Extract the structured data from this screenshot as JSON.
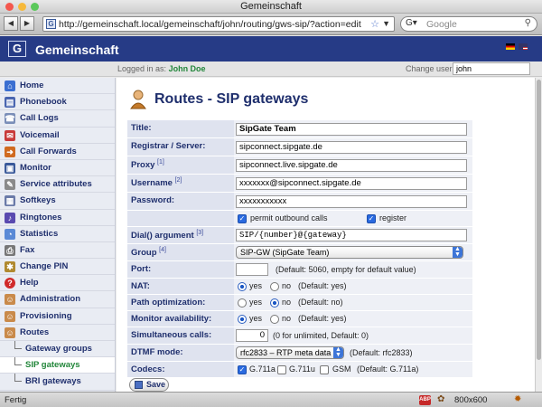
{
  "window": {
    "title": "Gemeinschaft"
  },
  "browser": {
    "url": "http://gemeinschaft.local/gemeinschaft/john/routing/gws-sip/?action=edit",
    "search_placeholder": "Google",
    "status": "Fertig",
    "resolution": "800x600"
  },
  "app": {
    "name": "Gemeinschaft",
    "logo_letter": "G"
  },
  "userbar": {
    "logged_label": "Logged in as:",
    "user": "John Doe",
    "change_label": "Change user:",
    "change_value": "john"
  },
  "sidebar": {
    "items": [
      {
        "label": "Home",
        "icon": "home-icon"
      },
      {
        "label": "Phonebook",
        "icon": "phonebook-icon"
      },
      {
        "label": "Call Logs",
        "icon": "call-logs-icon"
      },
      {
        "label": "Voicemail",
        "icon": "voicemail-icon"
      },
      {
        "label": "Call Forwards",
        "icon": "call-forwards-icon"
      },
      {
        "label": "Monitor",
        "icon": "monitor-icon"
      },
      {
        "label": "Service attributes",
        "icon": "service-attributes-icon"
      },
      {
        "label": "Softkeys",
        "icon": "softkeys-icon"
      },
      {
        "label": "Ringtones",
        "icon": "ringtones-icon"
      },
      {
        "label": "Statistics",
        "icon": "statistics-icon"
      },
      {
        "label": "Fax",
        "icon": "fax-icon"
      },
      {
        "label": "Change PIN",
        "icon": "change-pin-icon"
      },
      {
        "label": "Help",
        "icon": "help-icon"
      },
      {
        "label": "Administration",
        "icon": "administration-icon"
      },
      {
        "label": "Provisioning",
        "icon": "provisioning-icon"
      },
      {
        "label": "Routes",
        "icon": "routes-icon"
      },
      {
        "label": "Gateway groups",
        "sub": true
      },
      {
        "label": "SIP gateways",
        "sub": true,
        "active": true
      },
      {
        "label": "BRI gateways",
        "sub": true
      }
    ]
  },
  "page": {
    "title": "Routes - SIP gateways"
  },
  "form": {
    "title_label": "Title:",
    "title_value": "SipGate Team",
    "registrar_label": "Registrar / Server:",
    "registrar_value": "sipconnect.sipgate.de",
    "proxy_label": "Proxy",
    "proxy_ref": "[1]",
    "proxy_value": "sipconnect.live.sipgate.de",
    "username_label": "Username",
    "username_ref": "[2]",
    "username_value": "xxxxxxx@sipconnect.sipgate.de",
    "password_label": "Password:",
    "password_value": "xxxxxxxxxxx",
    "permit_label": "permit outbound calls",
    "register_label": "register",
    "dial_label": "Dial() argument",
    "dial_ref": "[3]",
    "dial_value": "SIP/{number}@{gateway}",
    "group_label": "Group",
    "group_ref": "[4]",
    "group_value": "SIP-GW (SipGate Team)",
    "port_label": "Port:",
    "port_value": "",
    "port_note": "(Default: 5060, empty for default value)",
    "nat_label": "NAT:",
    "nat_yes": "yes",
    "nat_no": "no",
    "nat_note": "(Default: yes)",
    "path_label": "Path optimization:",
    "path_yes": "yes",
    "path_no": "no",
    "path_note": "(Default: no)",
    "monitor_label": "Monitor availability:",
    "monitor_yes": "yes",
    "monitor_no": "no",
    "monitor_note": "(Default: yes)",
    "simcalls_label": "Simultaneous calls:",
    "simcalls_value": "0",
    "simcalls_note": "(0 for unlimited, Default: 0)",
    "dtmf_label": "DTMF mode:",
    "dtmf_value": "rfc2833 – RTP meta data",
    "dtmf_note": "(Default: rfc2833)",
    "codecs_label": "Codecs:",
    "codec1": "G.711a",
    "codec2": "G.711u",
    "codec3": "GSM",
    "codecs_note": "(Default: G.711a)",
    "save_label": "Save"
  },
  "colors": {
    "header": "#263b86",
    "nav_text": "#1f2f6d",
    "active": "#22863a",
    "label_bg": "#dfe3ef"
  }
}
